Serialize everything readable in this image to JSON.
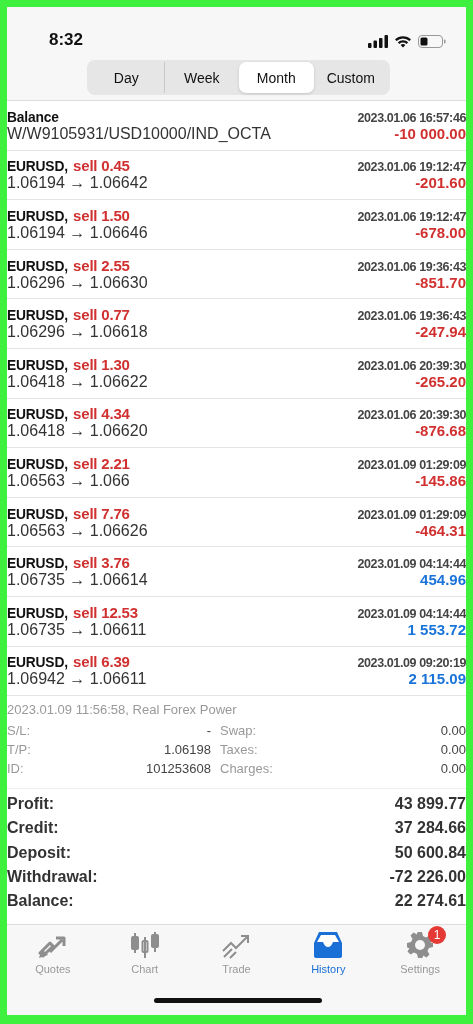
{
  "status_bar": {
    "time": "8:32"
  },
  "period_tabs": [
    {
      "label": "Day",
      "selected": false
    },
    {
      "label": "Week",
      "selected": false
    },
    {
      "label": "Month",
      "selected": true
    },
    {
      "label": "Custom",
      "selected": false
    }
  ],
  "deals": [
    {
      "kind": "balance",
      "title": "Balance",
      "time": "2023.01.06 16:57:46",
      "detail": "W/W9105931/USD10000/IND_OCTA",
      "amount": "-10 000.00",
      "color": "#d0302f"
    },
    {
      "kind": "trade",
      "symbol": "EURUSD,",
      "side": "sell 0.45",
      "time": "2023.01.06 19:12:47",
      "detail": "1.06194 → 1.06642",
      "amount": "-201.60",
      "color": "#d0302f"
    },
    {
      "kind": "trade",
      "symbol": "EURUSD,",
      "side": "sell 1.50",
      "time": "2023.01.06 19:12:47",
      "detail": "1.06194 → 1.06646",
      "amount": "-678.00",
      "color": "#d0302f"
    },
    {
      "kind": "trade",
      "symbol": "EURUSD,",
      "side": "sell 2.55",
      "time": "2023.01.06 19:36:43",
      "detail": "1.06296 → 1.06630",
      "amount": "-851.70",
      "color": "#d0302f"
    },
    {
      "kind": "trade",
      "symbol": "EURUSD,",
      "side": "sell 0.77",
      "time": "2023.01.06 19:36:43",
      "detail": "1.06296 → 1.06618",
      "amount": "-247.94",
      "color": "#d0302f"
    },
    {
      "kind": "trade",
      "symbol": "EURUSD,",
      "side": "sell 1.30",
      "time": "2023.01.06 20:39:30",
      "detail": "1.06418 → 1.06622",
      "amount": "-265.20",
      "color": "#d0302f"
    },
    {
      "kind": "trade",
      "symbol": "EURUSD,",
      "side": "sell 4.34",
      "time": "2023.01.06 20:39:30",
      "detail": "1.06418 → 1.06620",
      "amount": "-876.68",
      "color": "#d0302f"
    },
    {
      "kind": "trade",
      "symbol": "EURUSD,",
      "side": "sell 2.21",
      "time": "2023.01.09 01:29:09",
      "detail": "1.06563 → 1.066",
      "amount": "-145.86",
      "color": "#d0302f"
    },
    {
      "kind": "trade",
      "symbol": "EURUSD,",
      "side": "sell 7.76",
      "time": "2023.01.09 01:29:09",
      "detail": "1.06563 → 1.06626",
      "amount": "-464.31",
      "color": "#d0302f"
    },
    {
      "kind": "trade",
      "symbol": "EURUSD,",
      "side": "sell 3.76",
      "time": "2023.01.09 04:14:44",
      "detail": "1.06735 → 1.06614",
      "amount": "454.96",
      "color": "#1a73d9"
    },
    {
      "kind": "trade",
      "symbol": "EURUSD,",
      "side": "sell 12.53",
      "time": "2023.01.09 04:14:44",
      "detail": "1.06735 → 1.06611",
      "amount": "1 553.72",
      "color": "#1a73d9"
    },
    {
      "kind": "trade",
      "symbol": "EURUSD,",
      "side": "sell 6.39",
      "time": "2023.01.09 09:20:19",
      "detail": "1.06942 → 1.06611",
      "amount": "2 115.09",
      "color": "#1a73d9"
    }
  ],
  "deal_details": {
    "header": "2023.01.09 11:56:58, Real Forex Power",
    "rows": [
      [
        {
          "label": "S/L:",
          "value": "-"
        },
        {
          "label": "Swap:",
          "value": "0.00"
        }
      ],
      [
        {
          "label": "T/P:",
          "value": "1.06198"
        },
        {
          "label": "Taxes:",
          "value": "0.00"
        }
      ],
      [
        {
          "label": "ID:",
          "value": "101253608"
        },
        {
          "label": "Charges:",
          "value": "0.00"
        }
      ]
    ]
  },
  "summary": [
    {
      "label": "Profit:",
      "value": "43 899.77"
    },
    {
      "label": "Credit:",
      "value": "37 284.66"
    },
    {
      "label": "Deposit:",
      "value": "50 600.84"
    },
    {
      "label": "Withdrawal:",
      "value": "-72 226.00"
    },
    {
      "label": "Balance:",
      "value": "22 274.61"
    }
  ],
  "tab_bar": [
    {
      "kind": "quotes",
      "label": "Quotes",
      "selected": false
    },
    {
      "kind": "chart",
      "label": "Chart",
      "selected": false
    },
    {
      "kind": "trade",
      "label": "Trade",
      "selected": false
    },
    {
      "kind": "history",
      "label": "History",
      "selected": true
    },
    {
      "kind": "settings",
      "label": "Settings",
      "selected": false,
      "badge": "1"
    }
  ]
}
